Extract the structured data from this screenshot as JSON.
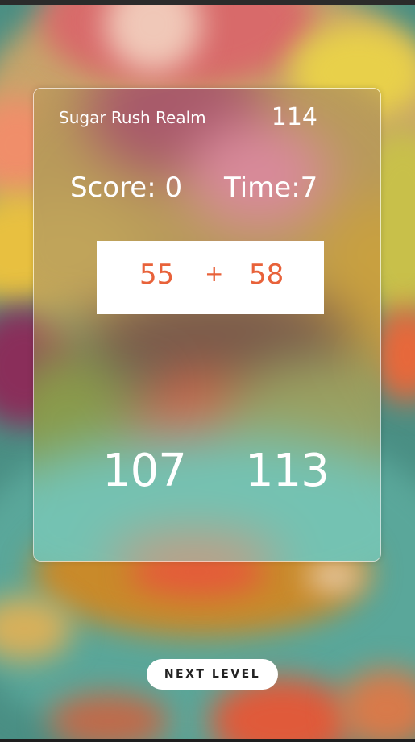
{
  "game": {
    "title": "Sugar Rush Realm",
    "target": "114",
    "score_label": "Score: 0",
    "time_label": "Time:7"
  },
  "equation": {
    "a": "55",
    "op": "+",
    "b": "58"
  },
  "answers": [
    "107",
    "113"
  ],
  "next_button": "NEXT LEVEL",
  "colors": {
    "equation_text": "#e8623a",
    "card_border": "#ffffff",
    "button_bg": "#ffffff"
  }
}
